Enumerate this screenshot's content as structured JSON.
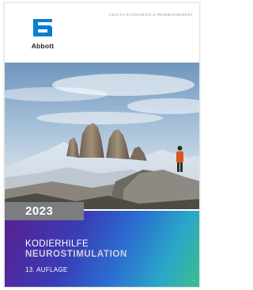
{
  "cover": {
    "tagline": "HEALTH ECONOMICS & REIMBURSEMENT",
    "brand": {
      "name": "Abbott",
      "color": "#0a7fd0"
    },
    "year": "2023",
    "title_line1": "KODIERHILFE",
    "title_line2": "NEUROSTIMULATION",
    "edition": "13. AUFLAGE",
    "page_mark": "1"
  },
  "colors": {
    "year_box": "#7c7d80",
    "gradient": [
      "#5a1f8f",
      "#3a3cb5",
      "#2b6ccf",
      "#2aa6c9",
      "#3ebf8a"
    ]
  },
  "icons": [
    "abbott-logo-icon"
  ]
}
